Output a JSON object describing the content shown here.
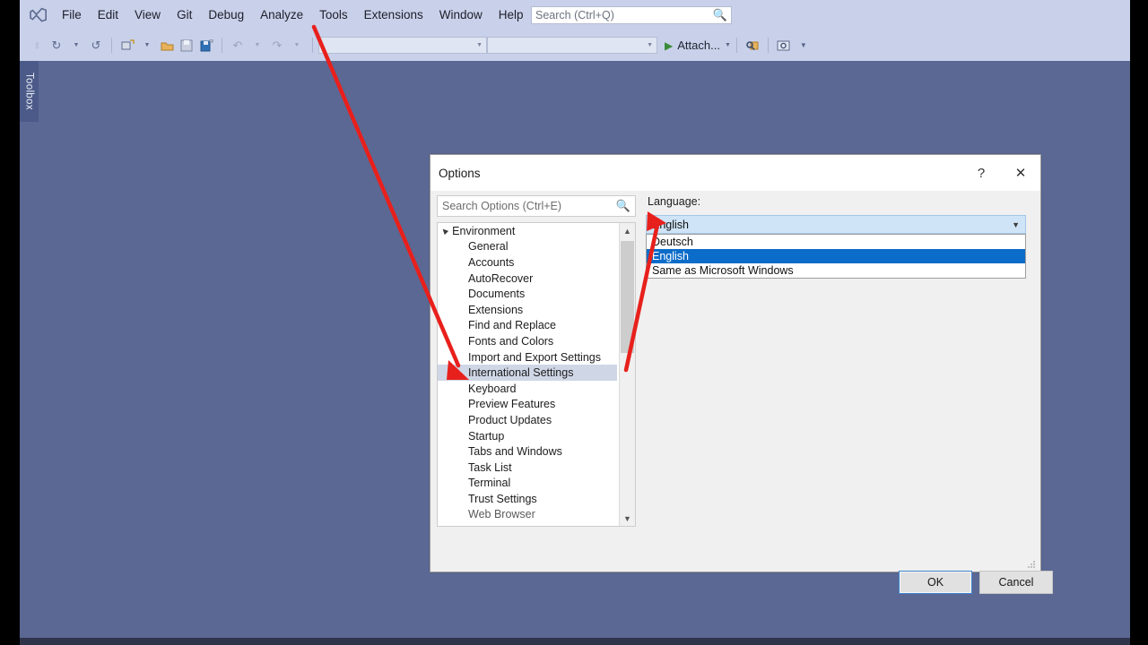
{
  "app": {
    "logo_icon": "visual-studio-icon",
    "menus": [
      "File",
      "Edit",
      "View",
      "Git",
      "Debug",
      "Analyze",
      "Tools",
      "Extensions",
      "Window",
      "Help"
    ],
    "search": {
      "placeholder": "Search (Ctrl+Q)",
      "icon": "search-icon"
    },
    "toolbar": {
      "attach_label": "Attach...",
      "play_icon": "play-triangle-icon",
      "navigate_back_icon": "navigate-back-icon",
      "navigate_forward_icon": "navigate-forward-icon",
      "new_project_icon": "new-project-icon",
      "open_file_icon": "open-file-icon",
      "save_icon": "save-icon",
      "save_all_icon": "save-all-icon",
      "undo_icon": "undo-icon",
      "redo_icon": "redo-icon",
      "dropdown_caret_icon": "chevron-down-icon",
      "attach_caret_icon": "chevron-down-icon",
      "find_icon": "find-in-files-icon",
      "window_icon": "window-layout-icon",
      "overflow_icon": "toolbar-overflow-icon"
    },
    "toolbox_tab_label": "Toolbox"
  },
  "dialog": {
    "title": "Options",
    "help_icon": "question-mark-icon",
    "close_icon": "close-icon",
    "search": {
      "placeholder": "Search Options (Ctrl+E)",
      "icon": "search-icon"
    },
    "tree": {
      "root": "Environment",
      "expander_icon": "triangle-expanded-icon",
      "items": [
        {
          "label": "General",
          "selected": false
        },
        {
          "label": "Accounts",
          "selected": false
        },
        {
          "label": "AutoRecover",
          "selected": false
        },
        {
          "label": "Documents",
          "selected": false
        },
        {
          "label": "Extensions",
          "selected": false
        },
        {
          "label": "Find and Replace",
          "selected": false
        },
        {
          "label": "Fonts and Colors",
          "selected": false
        },
        {
          "label": "Import and Export Settings",
          "selected": false
        },
        {
          "label": "International Settings",
          "selected": true
        },
        {
          "label": "Keyboard",
          "selected": false
        },
        {
          "label": "Preview Features",
          "selected": false
        },
        {
          "label": "Product Updates",
          "selected": false
        },
        {
          "label": "Startup",
          "selected": false
        },
        {
          "label": "Tabs and Windows",
          "selected": false
        },
        {
          "label": "Task List",
          "selected": false
        },
        {
          "label": "Terminal",
          "selected": false
        },
        {
          "label": "Trust Settings",
          "selected": false
        },
        {
          "label": "Web Browser",
          "selected": false
        }
      ],
      "scroll_up_icon": "chevron-up-icon",
      "scroll_down_icon": "chevron-down-icon"
    },
    "language": {
      "label": "Language:",
      "selected": "English",
      "chevron_icon": "chevron-down-icon",
      "options": [
        {
          "label": "Deutsch",
          "highlighted": false
        },
        {
          "label": "English",
          "highlighted": true
        },
        {
          "label": "Same as Microsoft Windows",
          "highlighted": false
        }
      ]
    },
    "buttons": {
      "ok": "OK",
      "cancel": "Cancel"
    },
    "resize_grip_icon": "resize-grip-icon"
  },
  "annotations": {
    "arrow_1": "red-arrow-tools-to-international-settings",
    "arrow_2": "red-arrow-to-language-dropdown",
    "color": "#e8201c"
  }
}
